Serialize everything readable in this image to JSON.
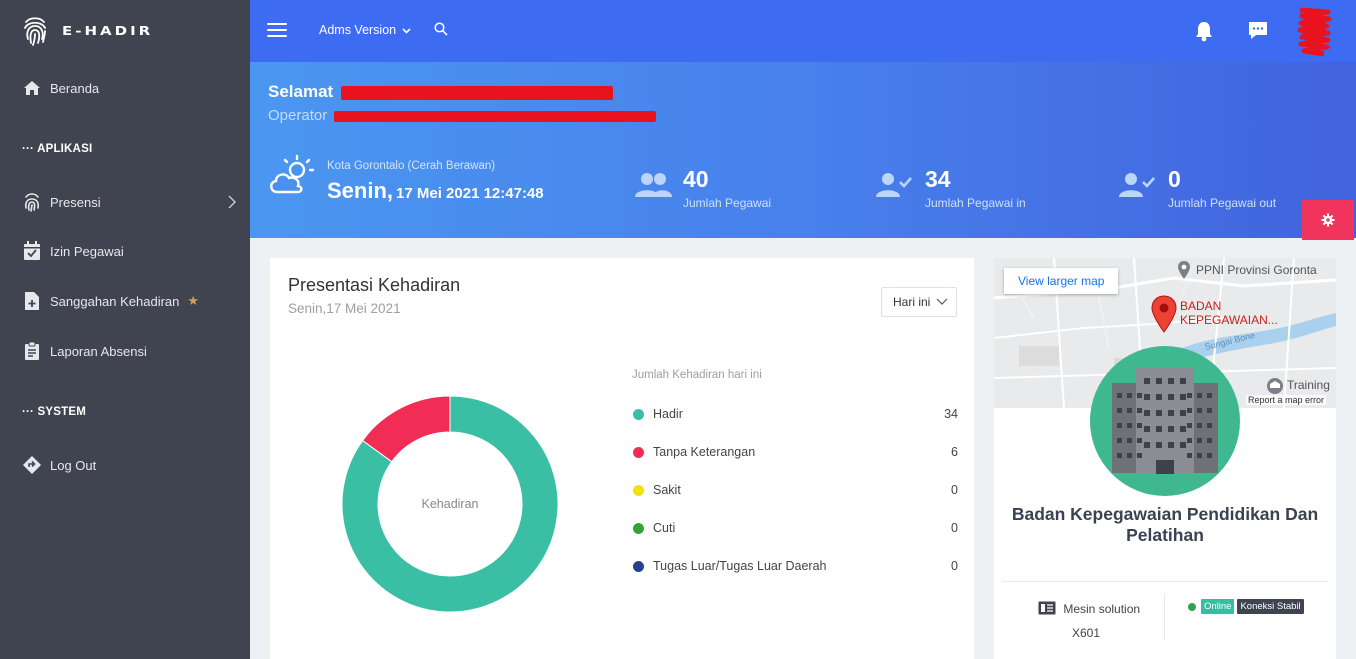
{
  "app": {
    "brand": "E-HADIR"
  },
  "sidebar": {
    "items": [
      {
        "label": "Beranda",
        "icon": "home-icon"
      },
      {
        "label": "Presensi",
        "icon": "fingerprint-icon"
      },
      {
        "label": "Izin Pegawai",
        "icon": "calendar-check-icon"
      },
      {
        "label": "Sanggahan Kehadiran",
        "icon": "file-plus-icon"
      },
      {
        "label": "Laporan Absensi",
        "icon": "clipboard-icon"
      },
      {
        "label": "Log Out",
        "icon": "logout-icon"
      }
    ],
    "sections": {
      "aplikasi": "APLIKASI",
      "system": "SYSTEM"
    }
  },
  "topbar": {
    "version_label": "Adms Version"
  },
  "banner": {
    "greeting": "Selamat",
    "operator": "Operator",
    "weather_location": "Kota Gorontalo (Cerah Berawan)",
    "day": "Senin,",
    "datetime": "17 Mei 2021 12:47:48",
    "stats": [
      {
        "value": "40",
        "label": "Jumlah Pegawai"
      },
      {
        "value": "34",
        "label": "Jumlah Pegawai in"
      },
      {
        "value": "0",
        "label": "Jumlah Pegawai out"
      }
    ]
  },
  "attendance": {
    "title": "Presentasi Kehadiran",
    "subtitle": "Senin,17 Mei 2021",
    "filter": "Hari ini",
    "center_label": "Kehadiran",
    "legend_title": "Jumlah Kehadiran hari ini",
    "legend": [
      {
        "name": "Hadir",
        "value": "34",
        "color": "#3abfa5"
      },
      {
        "name": "Tanpa Keterangan",
        "value": "6",
        "color": "#f22d55"
      },
      {
        "name": "Sakit",
        "value": "0",
        "color": "#f2e10b"
      },
      {
        "name": "Cuti",
        "value": "0",
        "color": "#36a33a"
      },
      {
        "name": "Tugas Luar/Tugas Luar Daerah",
        "value": "0",
        "color": "#27418f"
      }
    ]
  },
  "chart_data": {
    "type": "pie",
    "categories": [
      "Hadir",
      "Tanpa Keterangan",
      "Sakit",
      "Cuti",
      "Tugas Luar/Tugas Luar Daerah"
    ],
    "values": [
      34,
      6,
      0,
      0,
      0
    ],
    "colors": [
      "#3abfa5",
      "#f22d55",
      "#f2e10b",
      "#36a33a",
      "#27418f"
    ],
    "title": "Presentasi Kehadiran"
  },
  "org_card": {
    "map_button": "View larger map",
    "map_place_1": "PPNI Provinsi Goronta",
    "map_place_2": "BADAN KEPEGAWAIAN...",
    "map_place_3": "Training",
    "map_report": "Report a map error",
    "map_street": "Sungai Bone",
    "name": "Badan Kepegawaian Pendidikan Dan Pelatihan",
    "machine_label": "Mesin solution",
    "machine_model": "X601",
    "status_online": "Online",
    "status_connection": "Koneksi Stabil"
  }
}
